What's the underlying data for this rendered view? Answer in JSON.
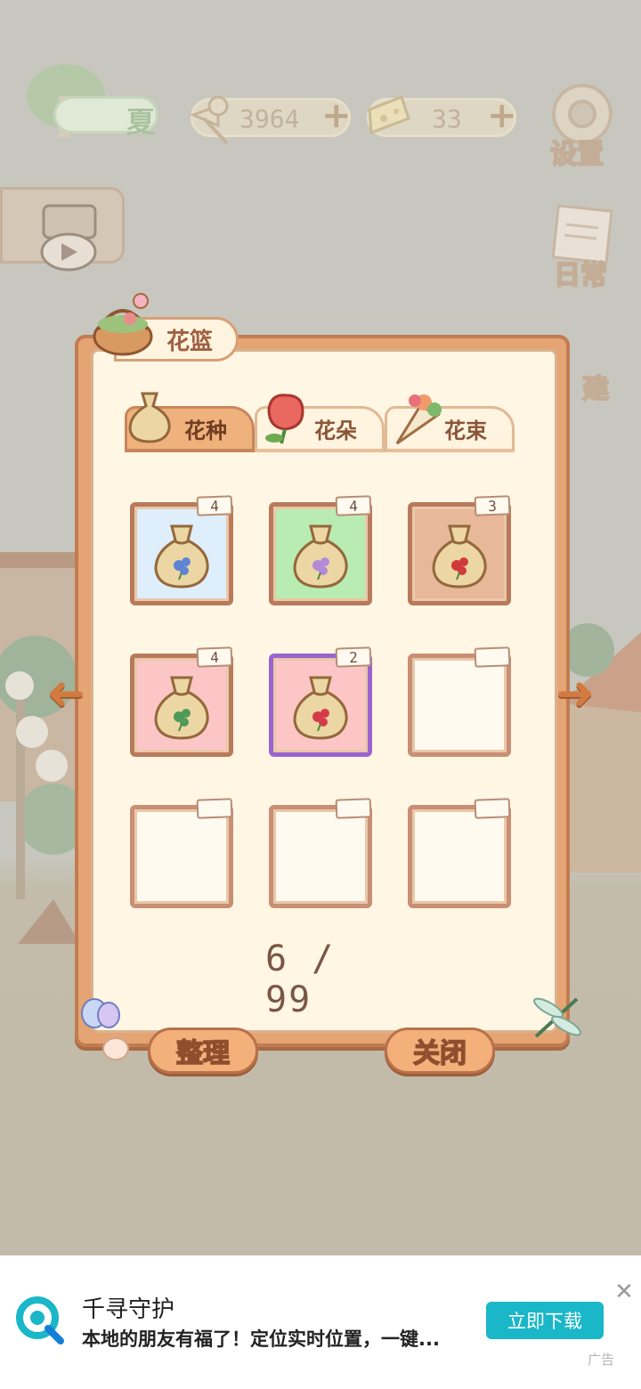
{
  "hud": {
    "season_label": "夏",
    "fish_count": "3964",
    "cheese_count": "33",
    "settings_label": "设置",
    "daily_label": "日常",
    "build_label": "建",
    "plus_symbol": "+"
  },
  "dialog": {
    "title": "花篮",
    "tabs": [
      {
        "label": "花种",
        "active": true
      },
      {
        "label": "花朵",
        "active": false
      },
      {
        "label": "花束",
        "active": false
      }
    ],
    "slots": [
      {
        "count": "4",
        "bg": "#dfeefb",
        "flower": "#5f84d6"
      },
      {
        "count": "4",
        "bg": "#b8ecb3",
        "flower": "#b38ad8"
      },
      {
        "count": "3",
        "bg": "#e8b89a",
        "flower": "#d03a3a"
      },
      {
        "count": "4",
        "bg": "#fcc6c6",
        "flower": "#4f9a58"
      },
      {
        "count": "2",
        "bg": "#fcc6c6",
        "flower": "#d63a4a"
      },
      {
        "count": "",
        "bg": "",
        "flower": ""
      },
      {
        "count": "",
        "bg": "",
        "flower": ""
      },
      {
        "count": "",
        "bg": "",
        "flower": ""
      },
      {
        "count": "",
        "bg": "",
        "flower": ""
      }
    ],
    "capacity": "6 / 99",
    "sort_label": "整理",
    "close_label": "关闭",
    "prev_arrow": "➜",
    "next_arrow": "➜"
  },
  "ad": {
    "title": "千寻守护",
    "description": "本地的朋友有福了！定位实时位置，一键...",
    "cta": "立即下载",
    "tag": "广告",
    "close_symbol": "✕"
  },
  "colors": {
    "slot_bg_blue": "#dfeefb",
    "slot_bg_green": "#b8ecb3",
    "slot_bg_tan": "#e8b89a",
    "slot_bg_pink": "#fcc6c6",
    "slot_border_rare": "#9a63cf",
    "ad_button": "#19b7c8"
  }
}
